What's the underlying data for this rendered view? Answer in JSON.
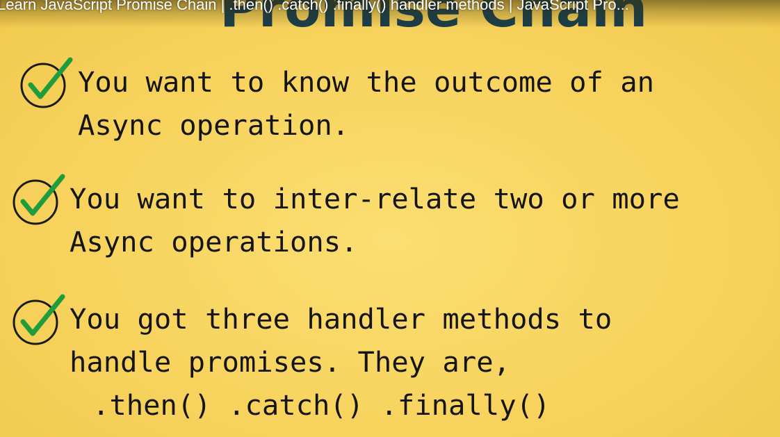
{
  "video": {
    "title": "Learn JavaScript Promise Chain | .then() .catch() .finally() handler methods | JavaScript Pro..."
  },
  "slide": {
    "heading": "Promise Chain",
    "heading_color": "#1a3e4c",
    "background_color": "#f8d35f",
    "check_color": "#1f9d3b",
    "points": [
      {
        "line1": "You want to know the outcome of an",
        "line2": "Async operation."
      },
      {
        "line1": "You want to inter-relate two or more",
        "line2": "Async operations."
      },
      {
        "line1": "You got three handler methods to",
        "line2": "handle promises. They are,",
        "line3": ".then() .catch() .finally()"
      }
    ]
  }
}
